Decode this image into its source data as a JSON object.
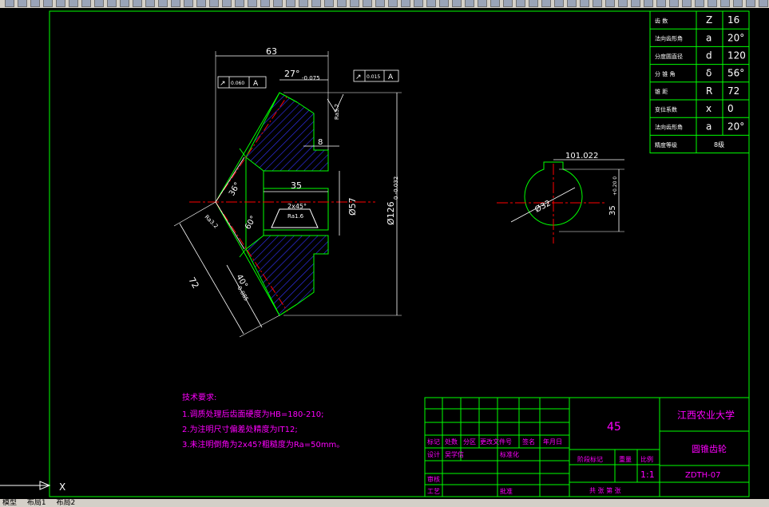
{
  "colors": {
    "background": "#000000",
    "frame": "#00ff00",
    "geometry": "#00ff00",
    "dimension": "#ffffff",
    "centerline": "#ff0000",
    "hatch": "#3333ff",
    "magenta_text": "#ff00ff",
    "table_text": "#ffffff"
  },
  "tech_notes": {
    "title": "技术要求:",
    "lines": [
      "1.调质处理后齿面硬度为HB=180-210;",
      "2.为注明尺寸偏差处精度为IT12;",
      "3.未注明倒角为2x45?粗糙度为Ra=50mm。"
    ]
  },
  "param_table": [
    {
      "name": "齿 数",
      "symbol": "Z",
      "value": "16"
    },
    {
      "name": "法向齿形角",
      "symbol": "a",
      "value": "20°"
    },
    {
      "name": "分度圆直径",
      "symbol": "d",
      "value": "120"
    },
    {
      "name": "分 锥 角",
      "symbol": "δ",
      "value": "56°"
    },
    {
      "name": "锥 距",
      "symbol": "R",
      "value": "72"
    },
    {
      "name": "变位系数",
      "symbol": "x",
      "value": "0"
    },
    {
      "name": "法向齿形角",
      "symbol": "a",
      "value": "20°"
    },
    {
      "name": "精度等级",
      "symbol": "",
      "value": "8级"
    }
  ],
  "title_block": {
    "drawing_number_big": "45",
    "school": "江西农业大学",
    "part_name": "圆锥齿轮",
    "drawing_code": "ZDTH-07",
    "scale": "1:1",
    "labels": {
      "mark": "标记",
      "count": "处数",
      "zone": "分区",
      "change_doc": "更改文件号",
      "sign": "签名",
      "date": "年月日",
      "design": "设计",
      "drafter": "吴学信",
      "standardize": "标准化",
      "stage_mark": "阶段标记",
      "weight": "重量",
      "ratio": "比例",
      "review": "审核",
      "process": "工艺",
      "approve": "批准",
      "sheets": "共 张 第 张"
    }
  },
  "dimensions": {
    "width_63": "63",
    "angle_27": "27°",
    "angle_27_tol": "-0.075",
    "gdt_left_val": "0.060",
    "gdt_left_ref": "A",
    "gdt_right_val": "0.015",
    "gdt_right_ref": "A",
    "rough_top": "Ra3.2",
    "dim_8": "8",
    "dim_35": "35",
    "chamfer": "2x45°",
    "rough_inner": "Ra1.6",
    "diam_57": "Ø57",
    "diam_126": "Ø126",
    "diam_126_tol": "0 -0.032",
    "angle_36": "36°",
    "angle_60": "60°",
    "rough_left": "Ra3.2",
    "dim_72": "72",
    "angle_40": "40°",
    "angle_40_tol": "-0.085",
    "key_101": "101.022",
    "key_35": "35",
    "key_35_tol": "+0.20 0",
    "key_diam_32": "Ø32"
  },
  "status_bar": {
    "model_tab": "模型",
    "layout1": "布局1",
    "layout2": "布局2"
  },
  "ucs_label": "X"
}
